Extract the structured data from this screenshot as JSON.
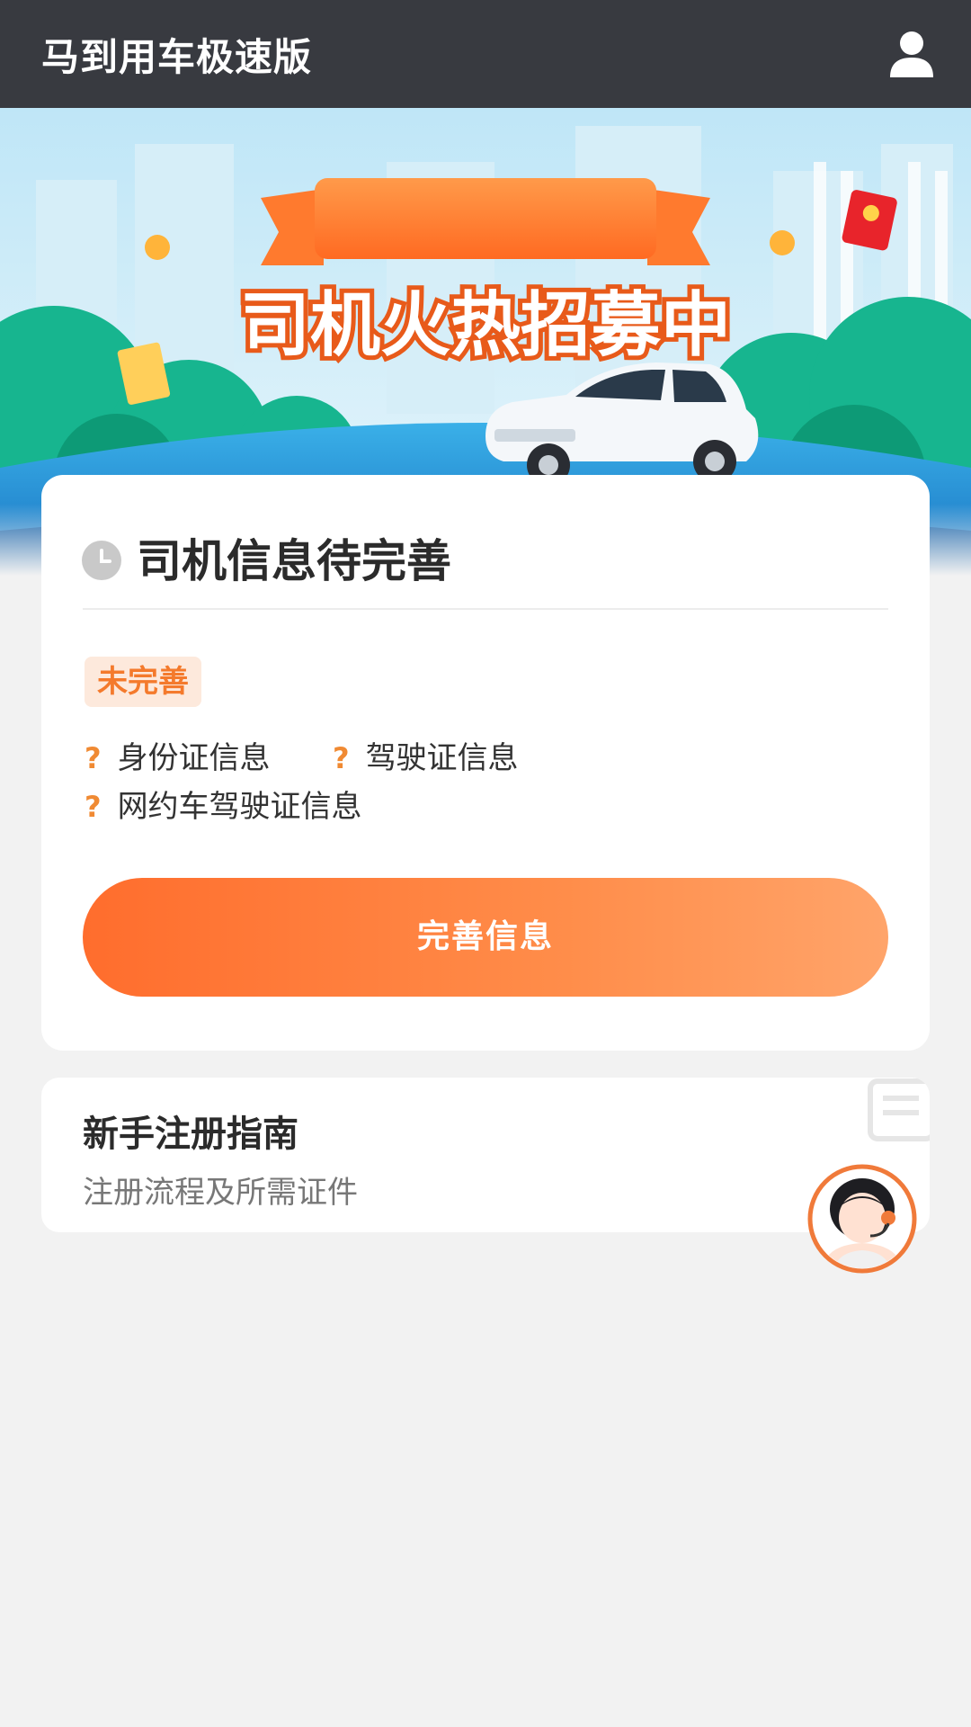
{
  "header": {
    "app_title": "马到用车极速版",
    "user_icon": "user-icon"
  },
  "banner": {
    "headline": "司机火热招募中",
    "ribbon_text": ""
  },
  "driver_card": {
    "title": "司机信息待完善",
    "status_badge": "未完善",
    "requirements": [
      {
        "mark": "?",
        "label": "身份证信息"
      },
      {
        "mark": "?",
        "label": "驾驶证信息"
      },
      {
        "mark": "?",
        "label": "网约车驾驶证信息"
      }
    ],
    "action_button": "完善信息"
  },
  "guide_card": {
    "title": "新手注册指南",
    "subtitle": "注册流程及所需证件"
  },
  "colors": {
    "topbar": "#383a40",
    "accent_orange": "#ff7a33",
    "badge_bg": "#fde9dc",
    "question_mark": "#f08a33",
    "page_bg": "#f2f2f2"
  }
}
